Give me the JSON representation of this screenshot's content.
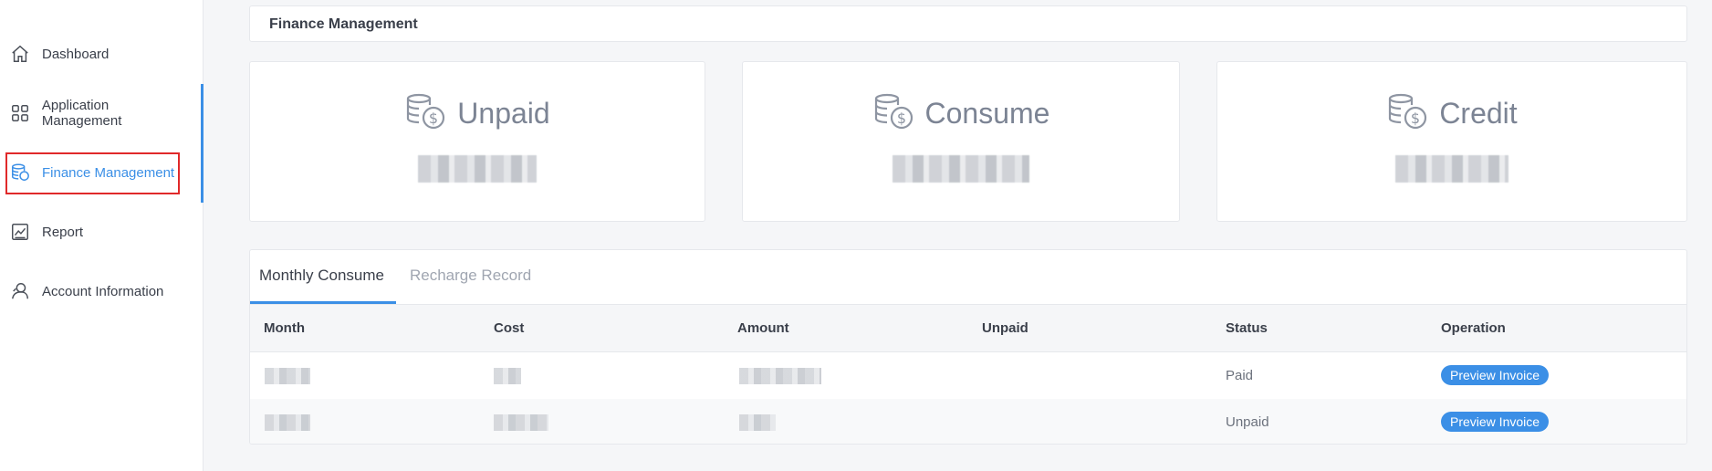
{
  "sidebar": {
    "items": [
      {
        "label": "Dashboard",
        "icon": "home-icon"
      },
      {
        "label": "Application Management",
        "icon": "grid-icon"
      },
      {
        "label": "Finance Management",
        "icon": "coins-icon",
        "active": true
      },
      {
        "label": "Report",
        "icon": "chart-icon"
      },
      {
        "label": "Account Information",
        "icon": "user-icon"
      }
    ]
  },
  "header": {
    "title": "Finance Management"
  },
  "cards": [
    {
      "label": "Unpaid",
      "icon": "coins-dollar-icon"
    },
    {
      "label": "Consume",
      "icon": "coins-dollar-icon"
    },
    {
      "label": "Credit",
      "icon": "coins-dollar-icon"
    }
  ],
  "tabs": [
    {
      "label": "Monthly Consume",
      "active": true
    },
    {
      "label": "Recharge Record",
      "active": false
    }
  ],
  "table": {
    "columns": [
      "Month",
      "Cost",
      "Amount",
      "Unpaid",
      "Status",
      "Operation"
    ],
    "rows": [
      {
        "status": "Paid",
        "operation": "Preview Invoice"
      },
      {
        "status": "Unpaid",
        "operation": "Preview Invoice"
      }
    ]
  },
  "colors": {
    "accent": "#3b8fe6",
    "highlight": "#e0292a"
  }
}
